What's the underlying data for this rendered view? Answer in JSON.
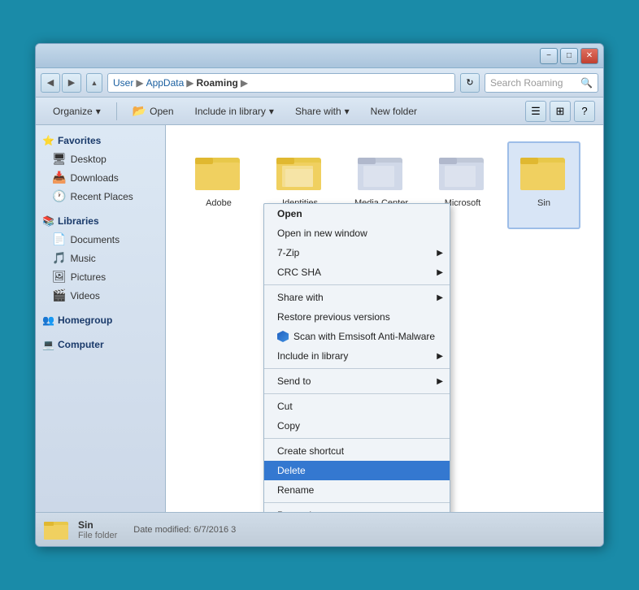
{
  "window": {
    "title": "Roaming"
  },
  "titlebar": {
    "minimize": "−",
    "maximize": "□",
    "close": "✕"
  },
  "addressbar": {
    "nav_back": "◀",
    "nav_forward": "▶",
    "path": [
      "User",
      "AppData",
      "Roaming"
    ],
    "refresh": "↻",
    "search_placeholder": "Search Roaming"
  },
  "toolbar": {
    "organize": "Organize",
    "open": "Open",
    "include_library": "Include in library",
    "share_with": "Share with",
    "new_folder": "New folder",
    "dropdown_arrow": "▾"
  },
  "sidebar": {
    "favorites_label": "Favorites",
    "favorites_icon": "⭐",
    "items_favorites": [
      {
        "label": "Desktop",
        "icon": "🖥"
      },
      {
        "label": "Downloads",
        "icon": "📥"
      },
      {
        "label": "Recent Places",
        "icon": "🕐"
      }
    ],
    "libraries_label": "Libraries",
    "libraries_icon": "📚",
    "items_libraries": [
      {
        "label": "Documents",
        "icon": "📄"
      },
      {
        "label": "Music",
        "icon": "🎵"
      },
      {
        "label": "Pictures",
        "icon": "🖼"
      },
      {
        "label": "Videos",
        "icon": "🎬"
      }
    ],
    "homegroup_label": "Homegroup",
    "homegroup_icon": "👥",
    "computer_label": "Computer",
    "computer_icon": "💻"
  },
  "files": [
    {
      "name": "Adobe",
      "selected": false
    },
    {
      "name": "Identities",
      "selected": false
    },
    {
      "name": "Media Center\nPrograms",
      "selected": false
    },
    {
      "name": "Microsoft",
      "selected": false
    },
    {
      "name": "Sin",
      "selected": true
    }
  ],
  "context_menu": {
    "items": [
      {
        "label": "Open",
        "bold": true,
        "has_arrow": false,
        "has_shield": false,
        "separator_after": false,
        "highlighted": false
      },
      {
        "label": "Open in new window",
        "bold": false,
        "has_arrow": false,
        "has_shield": false,
        "separator_after": false,
        "highlighted": false
      },
      {
        "label": "7-Zip",
        "bold": false,
        "has_arrow": true,
        "has_shield": false,
        "separator_after": false,
        "highlighted": false
      },
      {
        "label": "CRC SHA",
        "bold": false,
        "has_arrow": true,
        "has_shield": false,
        "separator_after": true,
        "highlighted": false
      },
      {
        "label": "Share with",
        "bold": false,
        "has_arrow": true,
        "has_shield": false,
        "separator_after": false,
        "highlighted": false
      },
      {
        "label": "Restore previous versions",
        "bold": false,
        "has_arrow": false,
        "has_shield": false,
        "separator_after": false,
        "highlighted": false
      },
      {
        "label": "Scan with Emsisoft Anti-Malware",
        "bold": false,
        "has_arrow": false,
        "has_shield": true,
        "separator_after": false,
        "highlighted": false
      },
      {
        "label": "Include in library",
        "bold": false,
        "has_arrow": true,
        "has_shield": false,
        "separator_after": true,
        "highlighted": false
      },
      {
        "label": "Send to",
        "bold": false,
        "has_arrow": true,
        "has_shield": false,
        "separator_after": true,
        "highlighted": false
      },
      {
        "label": "Cut",
        "bold": false,
        "has_arrow": false,
        "has_shield": false,
        "separator_after": false,
        "highlighted": false
      },
      {
        "label": "Copy",
        "bold": false,
        "has_arrow": false,
        "has_shield": false,
        "separator_after": true,
        "highlighted": false
      },
      {
        "label": "Create shortcut",
        "bold": false,
        "has_arrow": false,
        "has_shield": false,
        "separator_after": false,
        "highlighted": false
      },
      {
        "label": "Delete",
        "bold": false,
        "has_arrow": false,
        "has_shield": false,
        "separator_after": false,
        "highlighted": true
      },
      {
        "label": "Rename",
        "bold": false,
        "has_arrow": false,
        "has_shield": false,
        "separator_after": true,
        "highlighted": false
      },
      {
        "label": "Properties",
        "bold": false,
        "has_arrow": false,
        "has_shield": false,
        "separator_after": false,
        "highlighted": false
      }
    ]
  },
  "status_bar": {
    "name": "Sin",
    "type": "File folder",
    "date_label": "Date modified:",
    "date_value": "6/7/2016 3"
  }
}
